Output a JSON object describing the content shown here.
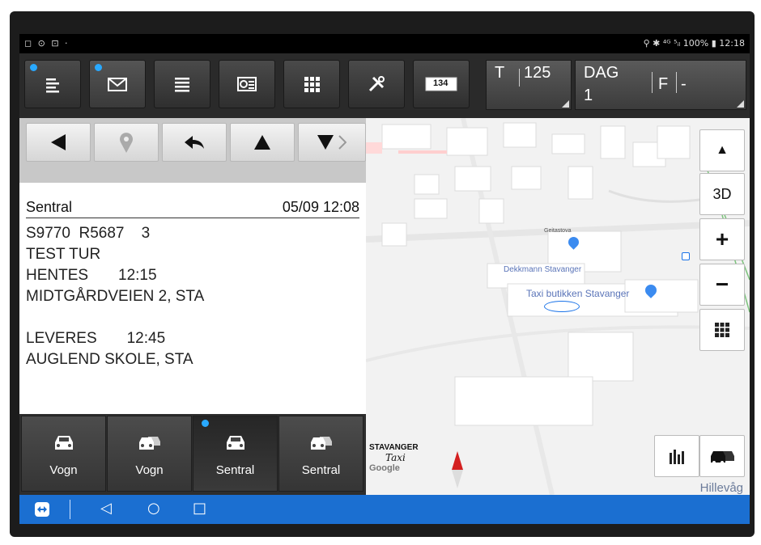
{
  "window": {
    "popout_icon": "popout-icon",
    "close_icon": "close-icon"
  },
  "statusbar": {
    "left_icons": "◻ ⊙ ⊡ ·",
    "right_text": "⚲ ✱ ⁴ᴳ ⁵ᵢₗ 100% ▮ 12:18"
  },
  "toolbar": {
    "buttons": [
      {
        "icon": "list-icon",
        "dot": true
      },
      {
        "icon": "mail-icon",
        "dot": true
      },
      {
        "icon": "menu-icon",
        "dot": false
      },
      {
        "icon": "camera-list-icon",
        "dot": false
      },
      {
        "icon": "grid-icon",
        "dot": false
      },
      {
        "icon": "tools-icon",
        "dot": false
      },
      {
        "icon": "taximeter-icon",
        "dot": false
      }
    ],
    "taximeter_label": "134",
    "field_t_label": "T",
    "field_t_value": "125",
    "field_dag_label": "DAG",
    "field_dag_value": "1",
    "field_f_label": "F",
    "field_f_value": "-"
  },
  "message": {
    "sender": "Sentral",
    "timestamp": "05/09 12:08",
    "lines": [
      "S9770  R5687    3",
      "TEST TUR",
      "HENTES       12:15",
      "MIDTGÅRDVEIEN 2, STA",
      "",
      "LEVERES       12:45",
      "AUGLEND SKOLE, STA"
    ]
  },
  "bottom_tabs": [
    {
      "label": "Vogn",
      "icon": "car-icon",
      "active": false
    },
    {
      "label": "Vogn",
      "icon": "cars-icon",
      "active": false
    },
    {
      "label": "Sentral",
      "icon": "car-icon",
      "active": true
    },
    {
      "label": "Sentral",
      "icon": "cars-icon",
      "active": false
    }
  ],
  "map": {
    "labels": {
      "street": "Geitastova",
      "poi1": "Dekkmann Stavanger",
      "poi2": "Taxi butikken Stavanger",
      "area": "Hillevåg",
      "logo_line1": "STAVANGER",
      "logo_line2": "Taxi",
      "google": "Google"
    },
    "controls": {
      "compass": "▲",
      "three_d": "3D",
      "zoom_in": "+",
      "zoom_out": "−"
    }
  },
  "colors": {
    "accent_dot": "#29a9ff",
    "navbar": "#1b6fd1"
  }
}
